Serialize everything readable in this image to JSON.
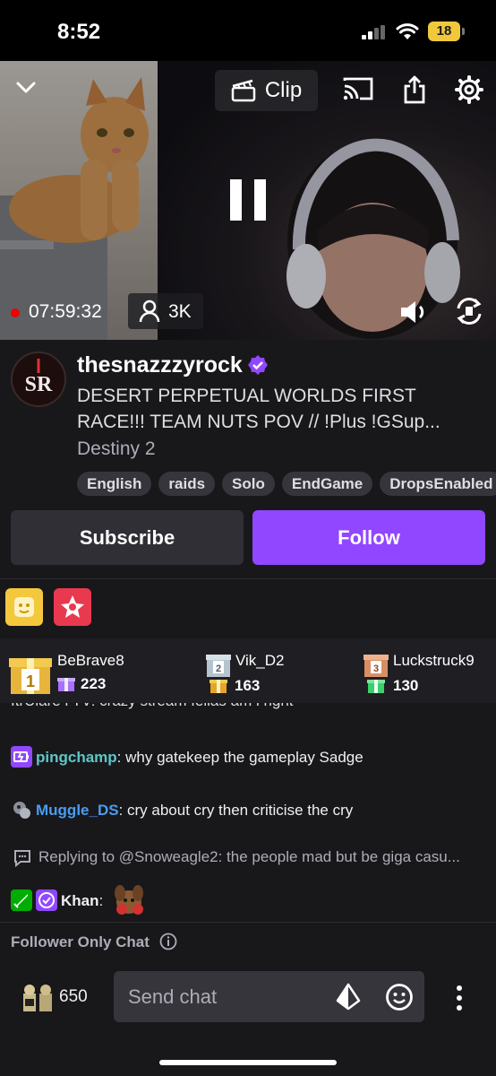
{
  "status_bar": {
    "time": "8:52",
    "battery": "18"
  },
  "player": {
    "clip_label": "Clip",
    "uptime": "07:59:32",
    "viewers": "3K"
  },
  "channel": {
    "name": "thesnazzzyrock",
    "avatar_text": "SR",
    "title": "DESERT PERPETUAL WORLDS FIRST RACE!!! TEAM NUTS POV // !Plus !GSup...",
    "game": "Destiny 2",
    "tags": [
      "English",
      "raids",
      "Solo",
      "EndGame",
      "DropsEnabled"
    ]
  },
  "actions": {
    "subscribe": "Subscribe",
    "follow": "Follow"
  },
  "leaderboard": [
    {
      "rank": "1",
      "name": "BeBrave8",
      "count": "223"
    },
    {
      "rank": "2",
      "name": "Vik_D2",
      "count": "163"
    },
    {
      "rank": "3",
      "name": "Luckstruck9",
      "count": "130"
    }
  ],
  "chat": {
    "partial_message": "ItrUlare i TV: crazy stream fellas am i right",
    "messages": [
      {
        "user": "pingchamp",
        "text": "why gatekeep the gameplay Sadge",
        "color": "#5ec7c7"
      },
      {
        "user": "Muggle_DS",
        "text": "cry about cry then criticise the cry",
        "color": "#4a9cf2"
      },
      {
        "user": "Khan",
        "text": "",
        "color": "#efeff1"
      }
    ],
    "reply_label": "Replying to @Snoweagle2: the people mad but be giga casu..."
  },
  "footer": {
    "follower_only": "Follower Only Chat",
    "bits": "650",
    "input_placeholder": "Send chat"
  },
  "colors": {
    "accent": "#9147ff",
    "live": "#eb0400",
    "background": "#18181b"
  }
}
